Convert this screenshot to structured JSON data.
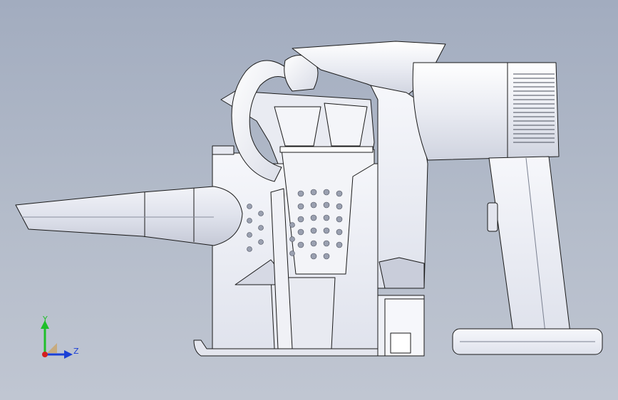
{
  "triad": {
    "y_label": "Y",
    "z_label": "Z",
    "colors": {
      "y": "#1fbf2a",
      "z": "#1a3fd6",
      "x": "#d41e1e"
    }
  },
  "colors": {
    "background_top": "#a2acbf",
    "background_bottom": "#c0c6d2",
    "body_fill": "#eef0f6",
    "outline": "#1a1a1a",
    "shade": "#c9cdda"
  }
}
